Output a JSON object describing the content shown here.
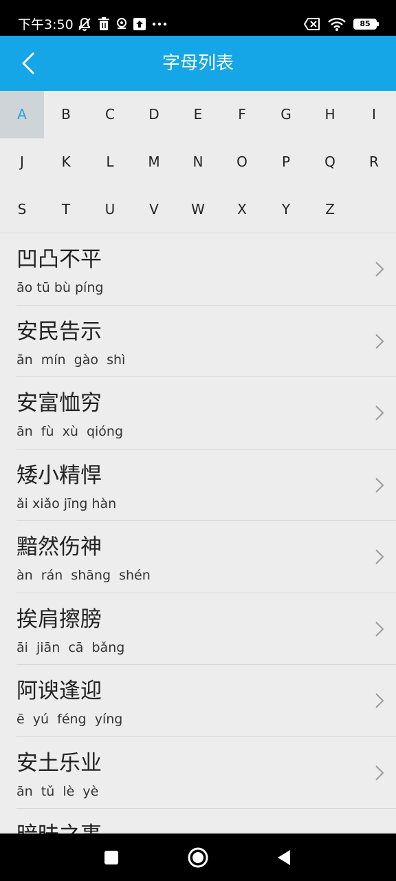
{
  "status_bar": {
    "time": "下午3:50",
    "left_icons": [
      "bell-off-icon",
      "trash-icon",
      "location-icon",
      "upload-icon",
      "more-icon"
    ],
    "battery_level": "85"
  },
  "app_bar": {
    "title": "字母列表"
  },
  "letters": {
    "selected": "A",
    "items": [
      "A",
      "B",
      "C",
      "D",
      "E",
      "F",
      "G",
      "H",
      "I",
      "J",
      "K",
      "L",
      "M",
      "N",
      "O",
      "P",
      "Q",
      "R",
      "S",
      "T",
      "U",
      "V",
      "W",
      "X",
      "Y",
      "Z"
    ]
  },
  "idioms": [
    {
      "name": "凹凸不平",
      "pinyin": "āo tū bù píng"
    },
    {
      "name": "安民告示",
      "pinyin": "ān  mín  gào  shì"
    },
    {
      "name": "安富恤穷",
      "pinyin": "ān  fù  xù  qióng"
    },
    {
      "name": "矮小精悍",
      "pinyin": "ǎi xiǎo jīng hàn"
    },
    {
      "name": "黯然伤神",
      "pinyin": "àn  rán  shāng  shén"
    },
    {
      "name": "挨肩擦膀",
      "pinyin": "āi  jiān  cā  bǎng"
    },
    {
      "name": "阿谀逢迎",
      "pinyin": "ē  yú  féng  yíng"
    },
    {
      "name": "安土乐业",
      "pinyin": "ān  tǔ  lè  yè"
    },
    {
      "name": "暗昧之事",
      "pinyin": ""
    }
  ],
  "colors": {
    "accent": "#14a6e6",
    "selected_letter_bg": "#cfd4d8",
    "selected_letter_text": "#2aa0e0"
  }
}
